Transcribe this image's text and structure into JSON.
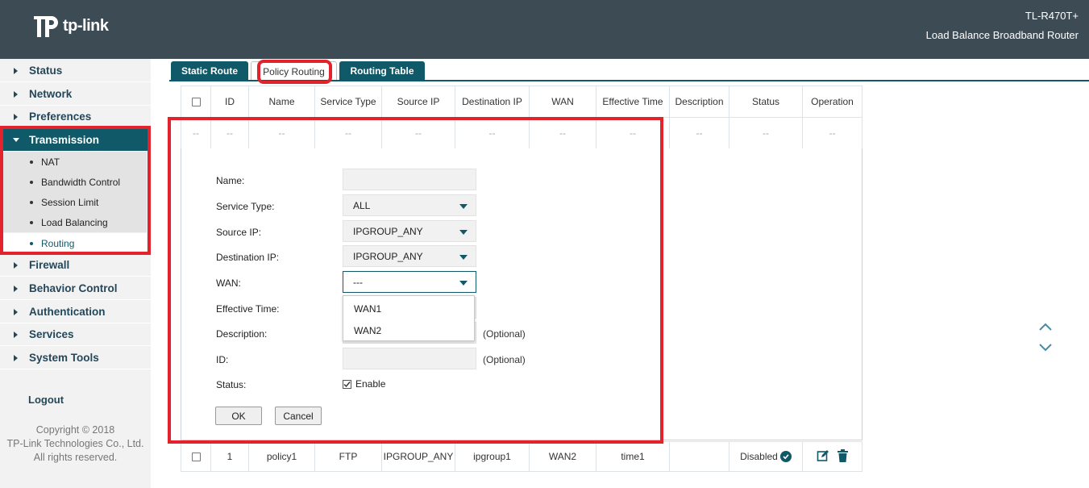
{
  "header": {
    "brand": "tp-link",
    "model": "TL-R470T+",
    "product": "Load Balance Broadband Router"
  },
  "sidebar": {
    "items": [
      {
        "label": "Status"
      },
      {
        "label": "Network"
      },
      {
        "label": "Preferences"
      },
      {
        "label": "Transmission",
        "expanded": true,
        "children": [
          {
            "label": "NAT"
          },
          {
            "label": "Bandwidth Control"
          },
          {
            "label": "Session Limit"
          },
          {
            "label": "Load Balancing"
          },
          {
            "label": "Routing",
            "selected": true
          }
        ]
      },
      {
        "label": "Firewall"
      },
      {
        "label": "Behavior Control"
      },
      {
        "label": "Authentication"
      },
      {
        "label": "Services"
      },
      {
        "label": "System Tools"
      }
    ],
    "logout": "Logout",
    "copyright": [
      "Copyright © 2018",
      "TP-Link Technologies Co., Ltd.",
      "All rights reserved."
    ]
  },
  "tabs": [
    {
      "label": "Static Route"
    },
    {
      "label": "Policy Routing",
      "active": true
    },
    {
      "label": "Routing Table"
    }
  ],
  "table": {
    "columns": [
      "ID",
      "Name",
      "Service Type",
      "Source IP",
      "Destination IP",
      "WAN",
      "Effective Time",
      "Description",
      "Status",
      "Operation"
    ],
    "placeholder": "--",
    "rows": [
      {
        "id": "1",
        "name": "policy1",
        "service_type": "FTP",
        "source_ip": "IPGROUP_ANY",
        "destination_ip": "ipgroup1",
        "wan": "WAN2",
        "effective_time": "time1",
        "description": "",
        "status": "Disabled"
      }
    ]
  },
  "form": {
    "name_label": "Name:",
    "name_value": "",
    "service_type_label": "Service Type:",
    "service_type_value": "ALL",
    "source_ip_label": "Source IP:",
    "source_ip_value": "IPGROUP_ANY",
    "destination_ip_label": "Destination IP:",
    "destination_ip_value": "IPGROUP_ANY",
    "wan_label": "WAN:",
    "wan_value": "---",
    "wan_options": [
      "WAN1",
      "WAN2"
    ],
    "effective_time_label": "Effective Time:",
    "description_label": "Description:",
    "description_hint": "(Optional)",
    "id_label": "ID:",
    "id_hint": "(Optional)",
    "status_label": "Status:",
    "status_enable_label": "Enable",
    "status_enabled": true,
    "ok_label": "OK",
    "cancel_label": "Cancel"
  },
  "colors": {
    "header_bg": "#3d4b55",
    "accent": "#0f5968",
    "highlight": "#e3232b"
  }
}
